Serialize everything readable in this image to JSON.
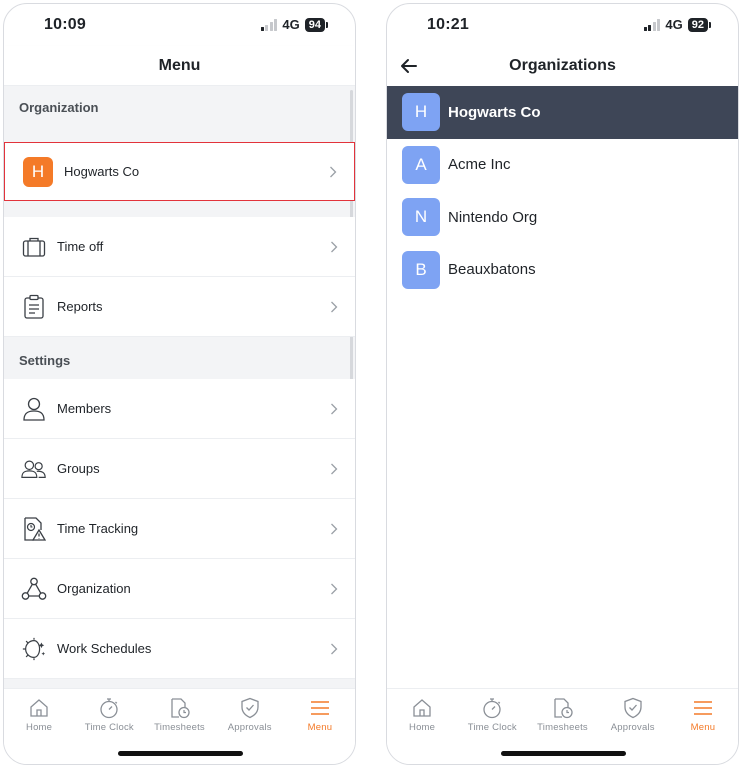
{
  "colors": {
    "accent_orange": "#f47a28",
    "selected_row": "#3e4657",
    "org_avatar_blue": "#7ea3f3",
    "highlight_red": "#e2333b",
    "tab_inactive": "#8a8f96"
  },
  "left": {
    "status": {
      "time": "10:09",
      "network": "4G",
      "battery": "94"
    },
    "title": "Menu",
    "organization_header": "Organization",
    "current_org": {
      "initial": "H",
      "name": "Hogwarts Co"
    },
    "top_items": [
      {
        "label": "Time off",
        "icon": "briefcase-icon"
      },
      {
        "label": "Reports",
        "icon": "clipboard-icon"
      }
    ],
    "settings_header": "Settings",
    "settings_items": [
      {
        "label": "Members",
        "icon": "person-icon"
      },
      {
        "label": "Groups",
        "icon": "people-icon"
      },
      {
        "label": "Time Tracking",
        "icon": "time-warning-icon"
      },
      {
        "label": "Organization",
        "icon": "org-structure-icon"
      },
      {
        "label": "Work Schedules",
        "icon": "day-night-icon"
      }
    ]
  },
  "right": {
    "status": {
      "time": "10:21",
      "network": "4G",
      "battery": "92"
    },
    "title": "Organizations",
    "organizations": [
      {
        "initial": "H",
        "name": "Hogwarts Co",
        "selected": true
      },
      {
        "initial": "A",
        "name": "Acme Inc",
        "selected": false
      },
      {
        "initial": "N",
        "name": "Nintendo Org",
        "selected": false
      },
      {
        "initial": "B",
        "name": "Beauxbatons",
        "selected": false
      }
    ]
  },
  "tabs": [
    {
      "label": "Home",
      "icon": "home-icon"
    },
    {
      "label": "Time Clock",
      "icon": "stopwatch-icon"
    },
    {
      "label": "Timesheets",
      "icon": "timesheet-icon"
    },
    {
      "label": "Approvals",
      "icon": "shield-check-icon"
    },
    {
      "label": "Menu",
      "icon": "hamburger-menu-icon",
      "active": true
    }
  ]
}
